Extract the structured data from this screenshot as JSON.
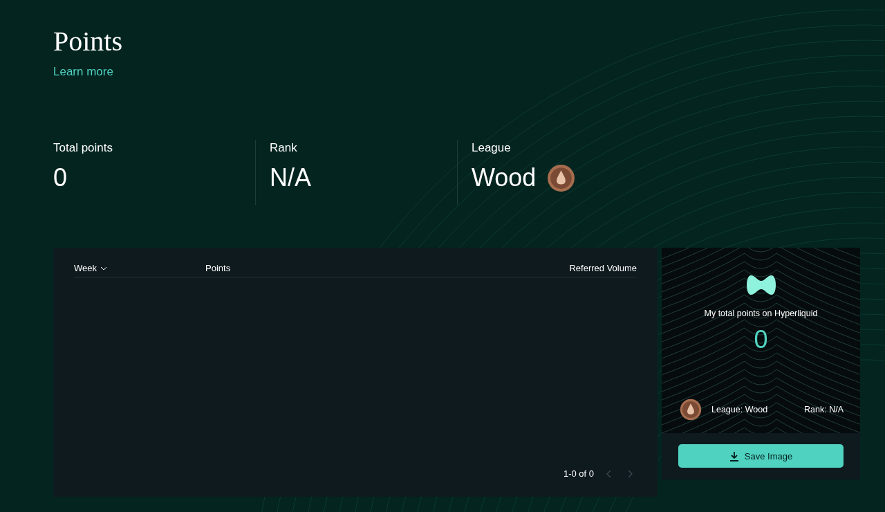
{
  "header": {
    "title": "Points",
    "link": "Learn more"
  },
  "stats": [
    {
      "label": "Total points",
      "value": "0",
      "kind": "plain"
    },
    {
      "label": "Rank",
      "value": "N/A",
      "kind": "plain"
    },
    {
      "label": "League",
      "value": "Wood",
      "kind": "badge"
    }
  ],
  "table": {
    "columns": [
      {
        "label": "Week",
        "sortable": true
      },
      {
        "label": "Points",
        "sortable": false
      },
      {
        "label": "Referred Volume",
        "sortable": false
      }
    ],
    "pagination": {
      "range": "1-0 of 0",
      "prev_disabled": true,
      "next_disabled": true
    }
  },
  "share_card": {
    "caption": "My total points on Hyperliquid",
    "points": "0",
    "league": "League: Wood",
    "rank": "Rank: N/A",
    "button": "Save Image"
  }
}
